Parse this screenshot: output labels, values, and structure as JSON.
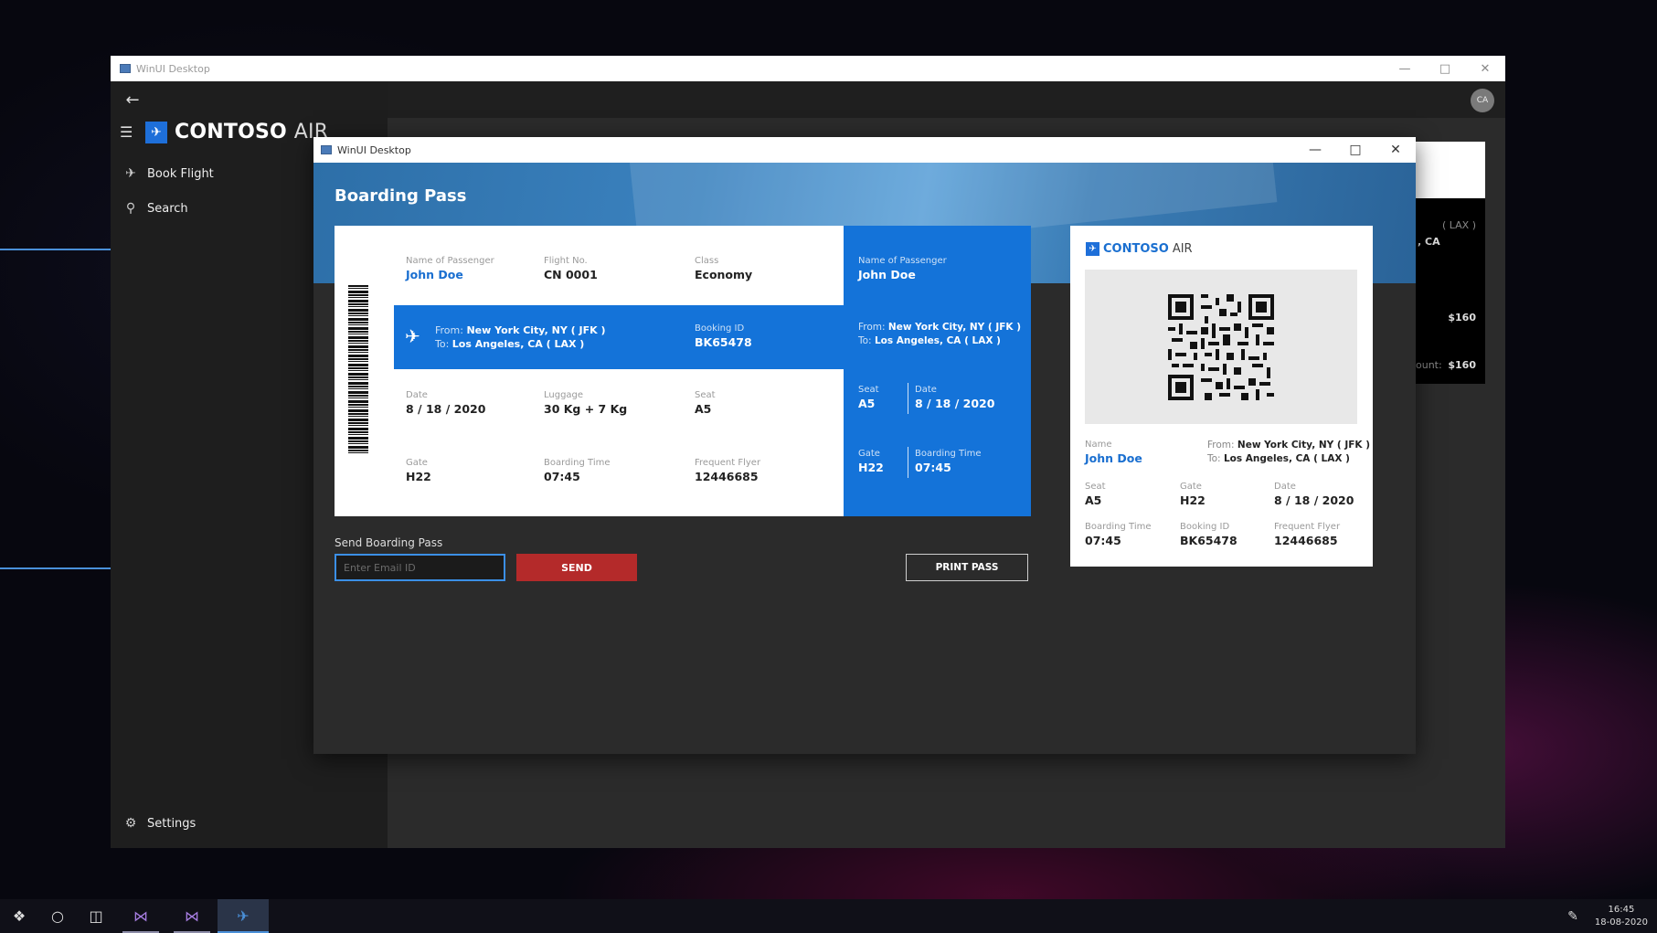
{
  "main_window": {
    "title": "WinUI Desktop",
    "avatar_initials": "CA",
    "brand": {
      "name_bold": "CONTOSO",
      "name_thin": "AIR"
    },
    "nav": [
      {
        "label": "Book Flight",
        "icon": "airplane-icon"
      },
      {
        "label": "Search",
        "icon": "search-icon"
      }
    ],
    "settings_label": "Settings",
    "background_card": {
      "route_partial": "( LAX )",
      "city_partial": ", CA",
      "price": "$160",
      "amount_label_partial": "ount:",
      "amount": "$160"
    }
  },
  "modal": {
    "title": "WinUI Desktop",
    "heading": "Boarding Pass",
    "ticket": {
      "passenger_label": "Name of Passenger",
      "passenger": "John Doe",
      "flight_label": "Flight No.",
      "flight": "CN 0001",
      "class_label": "Class",
      "class": "Economy",
      "from_prefix": "From:",
      "from": "New York City, NY ( JFK )",
      "to_prefix": "To:",
      "to": "Los Angeles, CA ( LAX )",
      "booking_label": "Booking ID",
      "booking": "BK65478",
      "date_label": "Date",
      "date": "8 / 18 / 2020",
      "luggage_label": "Luggage",
      "luggage": "30 Kg + 7 Kg",
      "seat_label": "Seat",
      "seat": "A5",
      "gate_label": "Gate",
      "gate": "H22",
      "boarding_label": "Boarding Time",
      "boarding": "07:45",
      "flyer_label": "Frequent Flyer",
      "flyer": "12446685"
    },
    "qr_card": {
      "brand_bold": "CONTOSO",
      "brand_thin": "AIR",
      "name_label": "Name",
      "name": "John Doe",
      "seat_label": "Seat",
      "gate_label": "Gate",
      "date_label": "Date",
      "boarding_label": "Boarding Time",
      "booking_label": "Booking ID",
      "flyer_label": "Frequent Flyer"
    },
    "send": {
      "label": "Send Boarding Pass",
      "placeholder": "Enter Email ID",
      "send_button": "SEND",
      "print_button": "PRINT PASS"
    }
  },
  "taskbar": {
    "time": "16:45",
    "date": "18-08-2020"
  },
  "colors": {
    "accent_blue": "#1473d9",
    "send_red": "#b42a2a",
    "focus_border": "#3b8fe6"
  }
}
